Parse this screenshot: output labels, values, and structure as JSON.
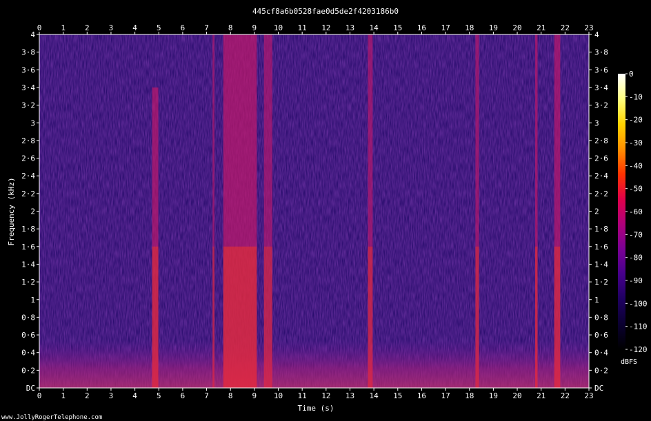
{
  "chart_data": {
    "type": "heatmap",
    "title": "445cf8a6b0528fae0d5de2f4203186b0",
    "xlabel": "Time (s)",
    "ylabel": "Frequency (kHz)",
    "xlim": [
      0,
      23
    ],
    "ylim": [
      0,
      4
    ],
    "x_ticks": [
      "0",
      "1",
      "2",
      "3",
      "4",
      "5",
      "6",
      "7",
      "8",
      "9",
      "10",
      "11",
      "12",
      "13",
      "14",
      "15",
      "16",
      "17",
      "18",
      "19",
      "20",
      "21",
      "22",
      "23"
    ],
    "y_ticks": [
      {
        "value": 0,
        "label": "DC"
      },
      {
        "value": 0.2,
        "label": "0·2"
      },
      {
        "value": 0.4,
        "label": "0·4"
      },
      {
        "value": 0.6,
        "label": "0·6"
      },
      {
        "value": 0.8,
        "label": "0·8"
      },
      {
        "value": 1.0,
        "label": "1"
      },
      {
        "value": 1.2,
        "label": "1·2"
      },
      {
        "value": 1.4,
        "label": "1·4"
      },
      {
        "value": 1.6,
        "label": "1·6"
      },
      {
        "value": 1.8,
        "label": "1·8"
      },
      {
        "value": 2.0,
        "label": "2"
      },
      {
        "value": 2.2,
        "label": "2·2"
      },
      {
        "value": 2.4,
        "label": "2·4"
      },
      {
        "value": 2.6,
        "label": "2·6"
      },
      {
        "value": 2.8,
        "label": "2·8"
      },
      {
        "value": 3.0,
        "label": "3"
      },
      {
        "value": 3.2,
        "label": "3·2"
      },
      {
        "value": 3.4,
        "label": "3·4"
      },
      {
        "value": 3.6,
        "label": "3·6"
      },
      {
        "value": 3.8,
        "label": "3·8"
      },
      {
        "value": 4.0,
        "label": "4"
      }
    ],
    "colorbar": {
      "unit": "dBFS",
      "range": [
        -120,
        0
      ],
      "ticks": [
        "0",
        "-10",
        "-20",
        "-30",
        "-40",
        "-50",
        "-60",
        "-70",
        "-80",
        "-90",
        "-100",
        "-110",
        "-120"
      ],
      "colors": [
        "#ffffff",
        "#ffff80",
        "#ffd400",
        "#ff9000",
        "#ff3300",
        "#e0004a",
        "#b0007a",
        "#7a0095",
        "#46008c",
        "#1e0060",
        "#0a0030",
        "#000000"
      ]
    },
    "background_color": "#2a0d6e",
    "events": [
      {
        "t_start": 4.72,
        "t_end": 4.98,
        "intensity": 0.9,
        "fmax": 3.4
      },
      {
        "t_start": 7.25,
        "t_end": 7.33,
        "intensity": 0.7,
        "fmax": 4.0
      },
      {
        "t_start": 7.7,
        "t_end": 9.1,
        "intensity": 1.0,
        "fmax": 4.0
      },
      {
        "t_start": 9.4,
        "t_end": 9.75,
        "intensity": 0.75,
        "fmax": 4.0
      },
      {
        "t_start": 13.75,
        "t_end": 13.95,
        "intensity": 0.8,
        "fmax": 4.0
      },
      {
        "t_start": 18.25,
        "t_end": 18.4,
        "intensity": 0.8,
        "fmax": 4.0
      },
      {
        "t_start": 20.75,
        "t_end": 20.85,
        "intensity": 0.9,
        "fmax": 4.0
      },
      {
        "t_start": 21.55,
        "t_end": 21.8,
        "intensity": 0.9,
        "fmax": 4.0
      }
    ],
    "grid": false
  },
  "footer": {
    "credit": "www.JollyRogerTelephone.com"
  }
}
